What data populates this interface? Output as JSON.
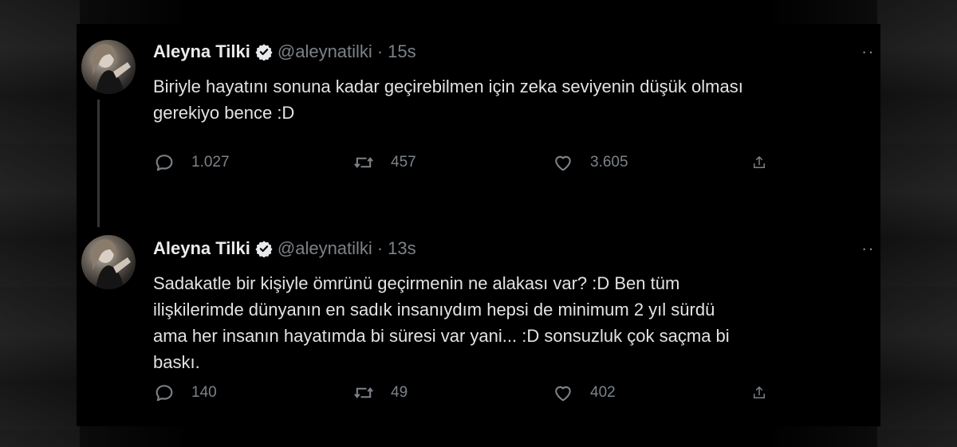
{
  "tweets": [
    {
      "name": "Aleyna Tilki",
      "handle": "@aleynatilki",
      "separator": "·",
      "time": "15s",
      "text": "Biriyle hayatını sonuna kadar geçirebilmen için zeka seviyenin düşük olması\ngerekiyo bence :D",
      "replies": "1.027",
      "retweets": "457",
      "likes": "3.605"
    },
    {
      "name": "Aleyna Tilki",
      "handle": "@aleynatilki",
      "separator": "·",
      "time": "13s",
      "text": "Sadakatle bir kişiyle ömrünü geçirmenin ne alakası var? :D Ben tüm\nilişkilerimde dünyanın en sadık insanıydım hepsi de minimum 2 yıl sürdü\nama her insanın hayatımda bi süresi var yani... :D sonsuzluk çok saçma bi\nbaskı.",
      "replies": "140",
      "retweets": "49",
      "likes": "402"
    }
  ],
  "icons": {
    "verified": "verified-badge-icon",
    "more": "more-icon",
    "reply": "reply-icon",
    "retweet": "retweet-icon",
    "like": "like-icon",
    "share": "share-icon"
  },
  "colors": {
    "background": "#000000",
    "text": "#e7e9ea",
    "muted": "#7c8288",
    "thread_line": "#333639"
  }
}
